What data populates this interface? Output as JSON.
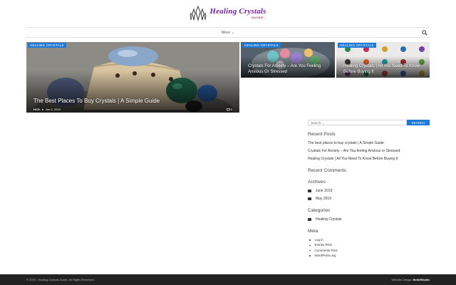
{
  "site": {
    "logo_title": "Healing Crystals",
    "logo_sub": "GUIDE.."
  },
  "nav": {
    "more_label": "More ⌄"
  },
  "featured": [
    {
      "tag": "HEALING CRYSTALS",
      "title": "The Best Places To Buy Crystals | A Simple Guide",
      "author": "HCG",
      "date": "Jun 2, 2019",
      "comments": "0"
    },
    {
      "tag": "HEALING CRYSTALS",
      "title": "Crystals For Anxiety – Are You Feeling Anxious Or Stressed"
    },
    {
      "tag": "HEALING CRYSTALS",
      "title": "Healing Crystals | All You Need To Know Before Buying It"
    }
  ],
  "sidebar": {
    "search_placeholder": "Search ...",
    "search_button": "SEARCH",
    "recent_posts_title": "Recent Posts",
    "recent_posts": [
      "The best places to buy crystals | A Simple Guide",
      "Crystals For Anxiety – Are You feeling Anxious or Stressed",
      "Healing Crystals | All You Need To Know Before Buying It"
    ],
    "recent_comments_title": "Recent Comments",
    "archives_title": "Archives",
    "archives": [
      "June 2019",
      "May 2019"
    ],
    "categories_title": "Categories",
    "categories": [
      "Healing Crystals"
    ],
    "meta_title": "Meta",
    "meta": [
      "Log in",
      "Entries RSS",
      "Comments RSS",
      "WordPress.org"
    ]
  },
  "footer": {
    "copyright": "© 2019 - Healing Crystals Guide. All Rights Reserved.",
    "design_label": "Website Design:",
    "design_by": "BeliefStudio"
  },
  "colors": {
    "accent": "#1e7ad6",
    "logo_purple": "#7a1fb0",
    "footer_bg": "#222222"
  }
}
